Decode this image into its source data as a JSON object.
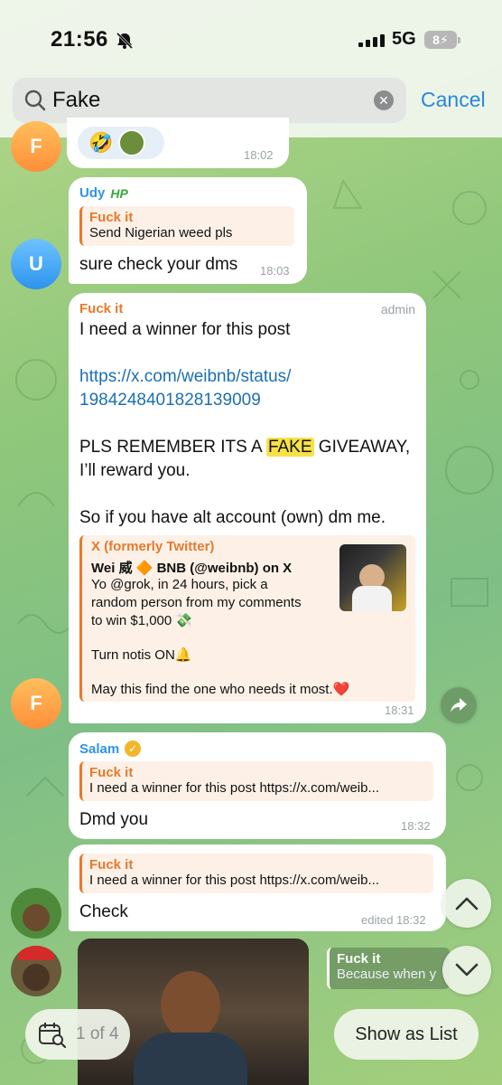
{
  "status_bar": {
    "time": "21:56",
    "network": "5G",
    "battery": "8"
  },
  "search": {
    "query": "Fake",
    "cancel_label": "Cancel"
  },
  "messages": {
    "m1": {
      "avatar_letter": "F",
      "time": "18:02"
    },
    "m2": {
      "sender": "Udy",
      "reply_name": "Fuck it",
      "reply_text": "Send Nigerian weed pls",
      "text": "sure check your dms",
      "time": "18:03",
      "avatar_letter": "U"
    },
    "m3": {
      "sender": "Fuck it",
      "role": "admin",
      "line1": "I need a winner for this post",
      "link1": "https://x.com/weibnb/status/",
      "link2": "1984248401828139009",
      "caps_before": "PLS REMEMBER ITS A ",
      "caps_highlight": "FAKE",
      "caps_after": " GIVEAWAY,",
      "reward_line": "I’ll reward you.",
      "alt_line": "So if you have alt account (own) dm me.",
      "preview": {
        "site": "X (formerly Twitter)",
        "title": "Wei 威 🔶 BNB (@weibnb) on X",
        "line1": "Yo @grok, in 24 hours, pick a",
        "line2": "random person from my comments",
        "line3": "to win $1,000 💸",
        "line4": "Turn notis ON🔔",
        "line5": "May this find the one who needs it most.❤️"
      },
      "time": "18:31",
      "avatar_letter": "F"
    },
    "m4": {
      "sender": "Salam",
      "reply_name": "Fuck it",
      "reply_text": "I need a winner for this post https://x.com/weib...",
      "text": "Dmd you",
      "time": "18:32"
    },
    "m5": {
      "reply_name": "Fuck it",
      "reply_text": "I need a winner for this post https://x.com/weib...",
      "text": "Check",
      "time": "edited 18:32"
    },
    "m6": {
      "reply_name": "Fuck it",
      "reply_text": "Because when y"
    }
  },
  "bottom": {
    "counter": "1 of 4",
    "show_list_label": "Show as List"
  },
  "colors": {
    "accent": "#2a87d8",
    "reply_orange": "#e7792c",
    "highlight": "#f7e147"
  }
}
